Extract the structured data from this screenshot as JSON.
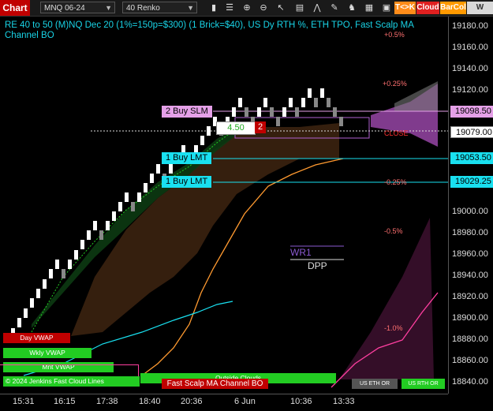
{
  "toolbar": {
    "app_label": "Chart",
    "instrument": "MNQ 06-24",
    "bar_type": "40 Renko",
    "buttons": {
      "tk": "T<>K",
      "cloud": "Cloud",
      "barcol": "BarCol",
      "vwap": "W VWA"
    },
    "colors": {
      "app": "#c00000",
      "tk": "#ff8c1a",
      "cloud": "#e02020",
      "barcol": "#ff9a00",
      "vwap": "#d9d9d9"
    }
  },
  "chart": {
    "title": "RE 40 to 50 (M)NQ Dec 20 (1%=150p=$300) (1 Brick=$40), US Dy RTH %, ETH TPO, Fast Scalp MA Channel BO",
    "price_labels": [
      "19180.00",
      "19160.00",
      "19140.00",
      "19120.00",
      "19098.50",
      "19079.00",
      "19053.50",
      "19029.25",
      "19000.00",
      "18980.00",
      "18960.00",
      "18940.00",
      "18920.00",
      "18900.00",
      "18880.00",
      "18860.00",
      "18840.00"
    ],
    "time_labels": [
      "15:31",
      "16:15",
      "17:38",
      "18:40",
      "20:36",
      "6 Jun",
      "10:36",
      "13:33"
    ],
    "orders": [
      {
        "label": "2 Buy SLM",
        "axis_price": "19098.50",
        "color": "#e5a0e8"
      },
      {
        "label": "1 Buy LMT",
        "axis_price": "19053.50",
        "color": "#19e0f0"
      },
      {
        "label": "1 Buy LMT",
        "axis_price": "19029.25",
        "color": "#19e0f0"
      }
    ],
    "current_price": "19079.00",
    "position": {
      "pnl": "4.50",
      "qty": "2"
    },
    "pct_labels": [
      "+0.5%",
      "+0.25%",
      "-0.25%",
      "-0.5%",
      "-1.0%"
    ],
    "pivots": {
      "wr1": "WR1",
      "dpp": "DPP",
      "close": "CLOSE"
    },
    "vwap_labels": [
      "Day VWAP",
      "Wkly VWAP",
      "Mnt VWAP"
    ],
    "bottom_labels": {
      "copyright": "© 2024 Jenkins Fast Cloud Lines",
      "outside_clouds": "Outside Clouds",
      "fast_scalp": "Fast Scalp MA Channel BO",
      "us_eth_1": "US ETH OR",
      "us_rth": "US RTH OR"
    },
    "colors": {
      "title": "#19d3e6",
      "bull_brick": "#ffffff",
      "bear_brick": "#808080",
      "cloud_orange": "#ff9a30",
      "cloud_magenta": "#ff3fa0",
      "vwap_cyan": "#19e0f0",
      "green": "#22cc22"
    }
  }
}
